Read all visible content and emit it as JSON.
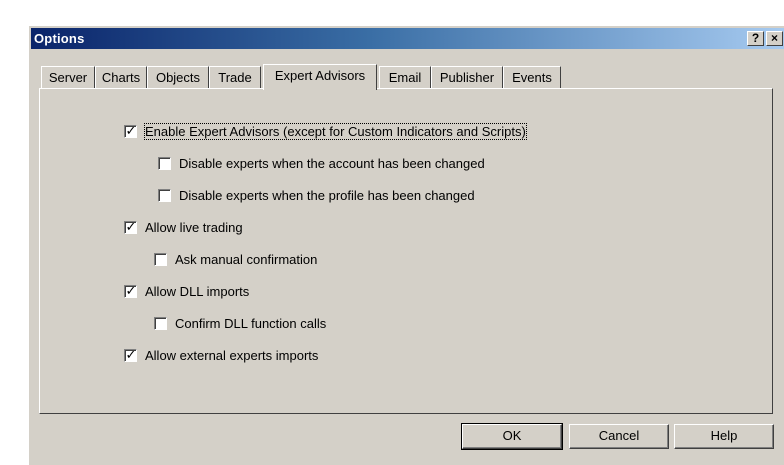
{
  "window": {
    "title": "Options",
    "help_button": "?",
    "close_button": "×"
  },
  "tabs": [
    {
      "label": "Server",
      "active": false
    },
    {
      "label": "Charts",
      "active": false
    },
    {
      "label": "Objects",
      "active": false
    },
    {
      "label": "Trade",
      "active": false
    },
    {
      "label": "Expert Advisors",
      "active": true
    },
    {
      "label": "Email",
      "active": false
    },
    {
      "label": "Publisher",
      "active": false
    },
    {
      "label": "Events",
      "active": false
    }
  ],
  "options": [
    {
      "label": "Enable Expert Advisors (except for Custom Indicators and Scripts)",
      "checked": true
    },
    {
      "label": "Disable experts when the account has been changed",
      "checked": false
    },
    {
      "label": "Disable experts when the profile has been changed",
      "checked": false
    },
    {
      "label": "Allow live trading",
      "checked": true
    },
    {
      "label": "Ask manual confirmation",
      "checked": false
    },
    {
      "label": "Allow DLL imports",
      "checked": true
    },
    {
      "label": "Confirm DLL function calls",
      "checked": false
    },
    {
      "label": "Allow external experts imports",
      "checked": true
    }
  ],
  "check_glyph": "✓",
  "buttons": {
    "ok": "OK",
    "cancel": "Cancel",
    "help": "Help"
  }
}
